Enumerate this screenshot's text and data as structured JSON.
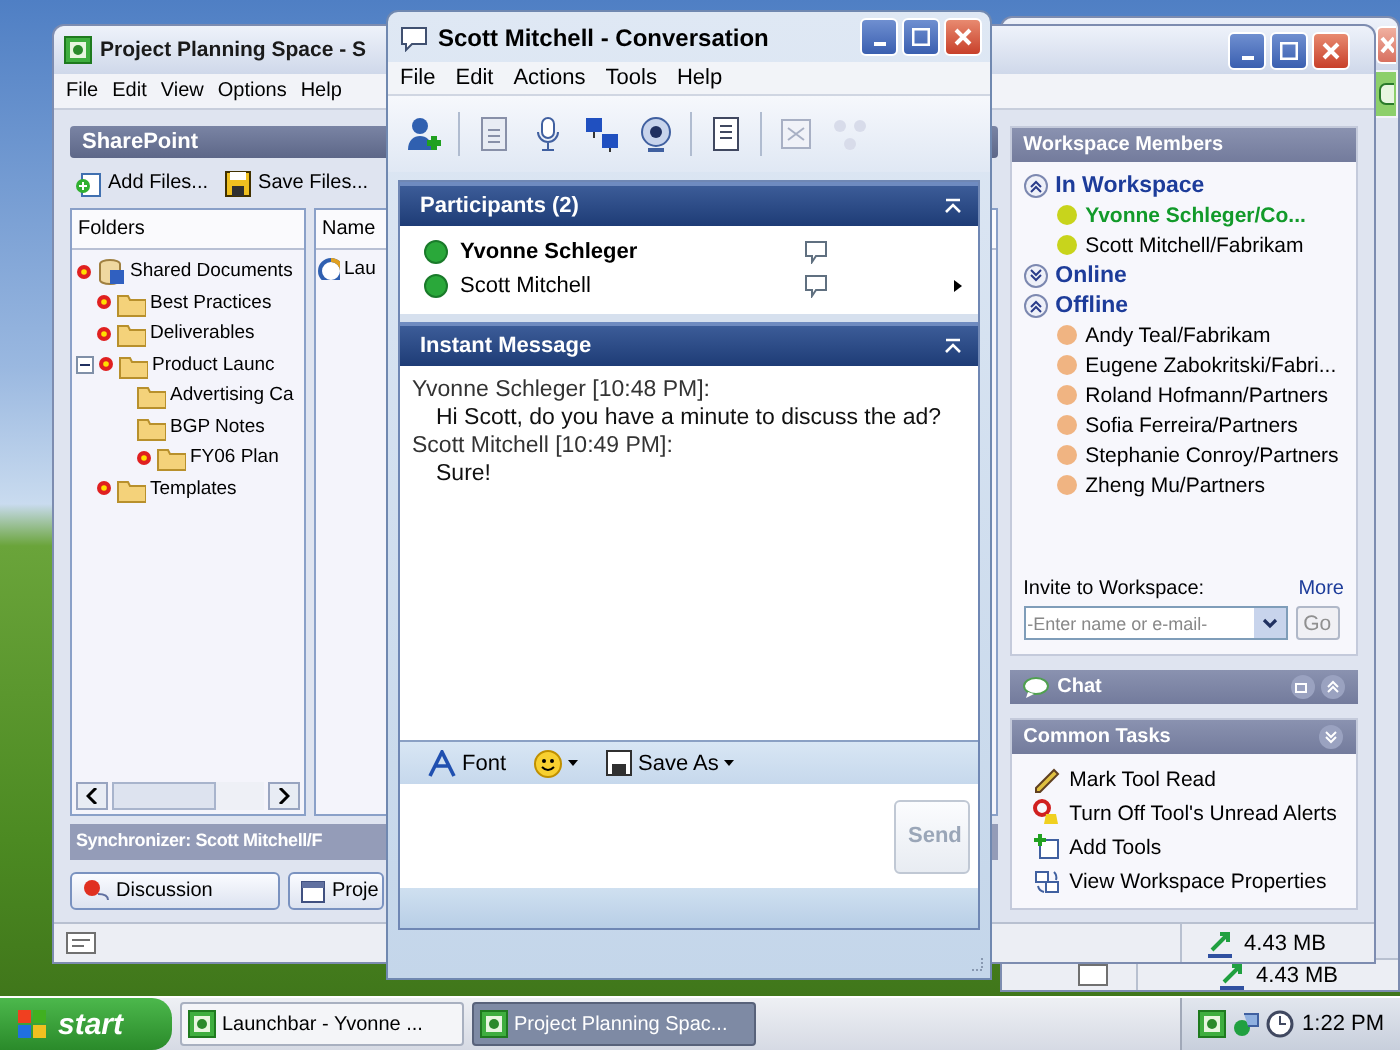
{
  "main_window": {
    "title": "Project Planning Space - S",
    "menu": [
      "File",
      "Edit",
      "View",
      "Options",
      "Help"
    ],
    "tool": {
      "title": "SharePoint",
      "actions": [
        "Add Files...",
        "Save Files..."
      ],
      "folders_header": "Folders",
      "folders": [
        {
          "label": "Shared Documents",
          "kind": "library",
          "unread": true,
          "children": [
            {
              "label": "Best Practices",
              "kind": "folder",
              "unread": true
            },
            {
              "label": "Deliverables",
              "kind": "folder",
              "unread": true
            },
            {
              "label": "Product Launc",
              "kind": "folder",
              "unread": true,
              "expanded": true,
              "children": [
                {
                  "label": "Advertising Ca",
                  "kind": "folder",
                  "unread": false
                },
                {
                  "label": "BGP Notes",
                  "kind": "folder",
                  "unread": false,
                  "children": [
                    {
                      "label": "FY06 Plan",
                      "kind": "folder",
                      "unread": true
                    }
                  ]
                }
              ]
            },
            {
              "label": "Templates",
              "kind": "folder",
              "unread": true
            }
          ]
        }
      ],
      "files_header": "Name",
      "files": [
        "Lau"
      ],
      "sync_status": "Synchronizer: Scott Mitchell/F"
    },
    "tool_tabs": [
      "Discussion",
      "Proje"
    ],
    "members": {
      "title": "Workspace Members",
      "groups": [
        {
          "label": "In Workspace",
          "expanded": true,
          "members": [
            {
              "name": "Yvonne Schleger/Co...",
              "color": "#c8d41c",
              "highlighted": true
            },
            {
              "name": "Scott Mitchell/Fabrikam",
              "color": "#c8d41c",
              "highlighted": false
            }
          ]
        },
        {
          "label": "Online",
          "expanded": false
        },
        {
          "label": "Offline",
          "expanded": true,
          "members": [
            {
              "name": "Andy Teal/Fabrikam",
              "color": "#f0b482",
              "highlighted": false
            },
            {
              "name": "Eugene Zabokritski/Fabri...",
              "color": "#f0b482",
              "highlighted": false
            },
            {
              "name": "Roland Hofmann/Partners",
              "color": "#f0b482",
              "highlighted": false
            },
            {
              "name": "Sofia Ferreira/Partners",
              "color": "#f0b482",
              "highlighted": false
            },
            {
              "name": "Stephanie Conroy/Partners",
              "color": "#f0b482",
              "highlighted": false
            },
            {
              "name": "Zheng Mu/Partners",
              "color": "#f0b482",
              "highlighted": false
            }
          ]
        }
      ],
      "invite_label": "Invite to Workspace:",
      "more_link": "More",
      "invite_placeholder": "-Enter name or e-mail-",
      "go_button": "Go"
    },
    "chat": {
      "title": "Chat"
    },
    "common_tasks": {
      "title": "Common Tasks",
      "items": [
        "Mark Tool Read",
        "Turn Off Tool's Unread Alerts",
        "Add Tools",
        "View Workspace Properties"
      ]
    },
    "status_size": "4.43 MB"
  },
  "back_window": {
    "status_size": "4.43 MB"
  },
  "conversation": {
    "title": "Scott Mitchell - Conversation",
    "menu": [
      "File",
      "Edit",
      "Actions",
      "Tools",
      "Help"
    ],
    "participants_title": "Participants (2)",
    "participants": [
      {
        "name": "Yvonne Schleger",
        "self": true
      },
      {
        "name": "Scott Mitchell",
        "self": false
      }
    ],
    "messages_title": "Instant Message",
    "messages": [
      {
        "sender": "Yvonne Schleger [10:48 PM]:",
        "text": "Hi Scott, do you have a minute to discuss the ad?"
      },
      {
        "sender": "Scott Mitchell [10:49 PM]:",
        "text": "Sure!"
      }
    ],
    "format_bar": {
      "font": "Font",
      "save_as": "Save As"
    },
    "send_button": {
      "label": "Send",
      "disabled": true
    }
  },
  "taskbar": {
    "start": "start",
    "buttons": [
      {
        "label": "Launchbar - Yvonne ...",
        "selected": false
      },
      {
        "label": "Project Planning Spac...",
        "selected": true
      }
    ],
    "clock": "1:22 PM"
  }
}
